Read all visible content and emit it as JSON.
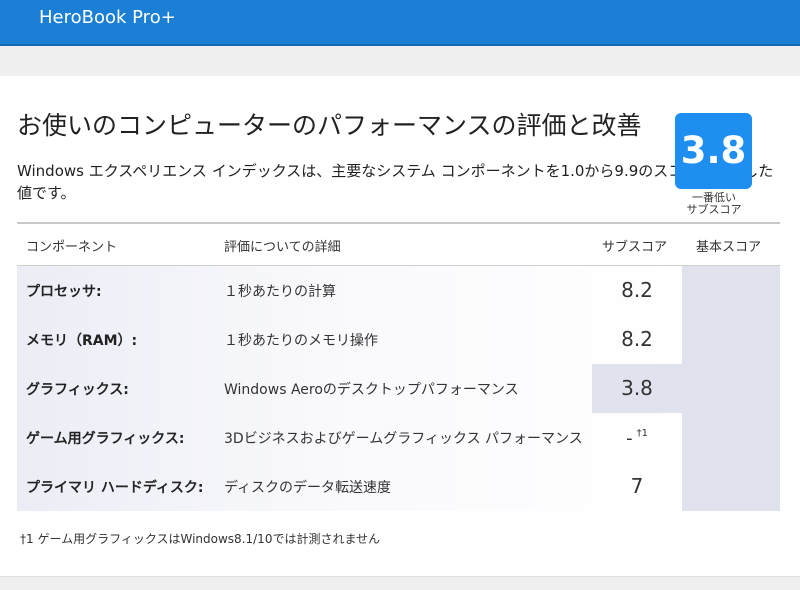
{
  "app": {
    "title": "HeroBook Pro+"
  },
  "page": {
    "heading": "お使いのコンピューターのパフォーマンスの評価と改善",
    "description": "Windows エクスペリエンス インデックスは、主要なシステム コンポーネントを1.0から9.9のスコアで評価した値です。"
  },
  "table": {
    "headers": {
      "component": "コンポーネント",
      "detail": "評価についての詳細",
      "subscore": "サブスコア",
      "basescore": "基本スコア"
    },
    "rows": [
      {
        "component": "プロセッサ:",
        "detail": "１秒あたりの計算",
        "subscore": "8.2"
      },
      {
        "component": "メモリ（RAM）:",
        "detail": "１秒あたりのメモリ操作",
        "subscore": "8.2"
      },
      {
        "component": "グラフィックス:",
        "detail": "Windows Aeroのデスクトップパフォーマンス",
        "subscore": "3.8"
      },
      {
        "component": "ゲーム用グラフィックス:",
        "detail": "3Dビジネスおよびゲームグラフィックス パフォーマンス",
        "subscore": "-",
        "note": "†1"
      },
      {
        "component": "プライマリ ハードディスク:",
        "detail": "ディスクのデータ転送速度",
        "subscore": "7"
      }
    ],
    "base_score": {
      "value": "3.8",
      "caption_line1": "一番低い",
      "caption_line2": "サブスコア"
    }
  },
  "footnote": "†1 ゲーム用グラフィックスはWindows8.1/10では計測されません",
  "colors": {
    "header_bar": "#1b7fd6",
    "score_box": "#1e8ff0",
    "base_column": "#e0e2ee"
  }
}
